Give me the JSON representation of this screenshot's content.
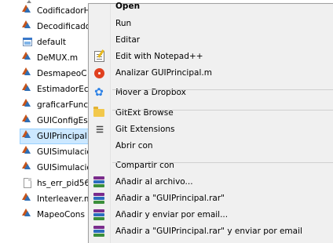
{
  "file_list": [
    {
      "name": "CodificadorH",
      "icon": "matlab-file-icon"
    },
    {
      "name": "Decodificado",
      "icon": "matlab-file-icon"
    },
    {
      "name": "default",
      "icon": "image-file-icon"
    },
    {
      "name": "DeMUX.m",
      "icon": "matlab-file-icon"
    },
    {
      "name": "DesmapeoC",
      "icon": "matlab-file-icon"
    },
    {
      "name": "EstimadorEc",
      "icon": "matlab-file-icon"
    },
    {
      "name": "graficarFunc",
      "icon": "matlab-file-icon"
    },
    {
      "name": "GUIConfigEs",
      "icon": "matlab-file-icon"
    },
    {
      "name": "GUIPrincipal",
      "icon": "matlab-file-icon",
      "selected": true
    },
    {
      "name": "GUISimulacio",
      "icon": "matlab-file-icon"
    },
    {
      "name": "GUISimulacio",
      "icon": "matlab-file-icon"
    },
    {
      "name": "hs_err_pid56",
      "icon": "plain-file-icon"
    },
    {
      "name": "Interleaver.m",
      "icon": "matlab-file-icon"
    },
    {
      "name": "MapeoCons",
      "icon": "matlab-file-icon"
    }
  ],
  "context_menu": {
    "items": [
      {
        "label": "Open",
        "bold": true,
        "icon": ""
      },
      {
        "label": "Run",
        "icon": ""
      },
      {
        "label": "Editar",
        "icon": ""
      },
      {
        "label": "Edit with Notepad++",
        "icon": "notepad-icon"
      },
      {
        "label": "Analizar GUIPrincipal.m",
        "icon": "analyze-icon"
      },
      {
        "label": "Mover a Dropbox",
        "icon": "dropbox-icon"
      },
      {
        "label": "GitExt Browse",
        "icon": "folder-icon"
      },
      {
        "label": "Git Extensions",
        "icon": "git-extensions-icon"
      },
      {
        "label": "Abrir con",
        "icon": ""
      },
      {
        "label": "Compartir con",
        "icon": ""
      },
      {
        "label": "Añadir al archivo...",
        "icon": "winrar-icon"
      },
      {
        "label": "Añadir a \"GUIPrincipal.rar\"",
        "icon": "winrar-icon"
      },
      {
        "label": "Añadir y enviar por email...",
        "icon": "winrar-icon"
      },
      {
        "label": "Añadir a \"GUIPrincipal.rar\" y enviar por email",
        "icon": "winrar-icon"
      }
    ]
  },
  "colors": {
    "selection_bg": "#cce8ff",
    "menu_bg": "#f0f0f0"
  }
}
